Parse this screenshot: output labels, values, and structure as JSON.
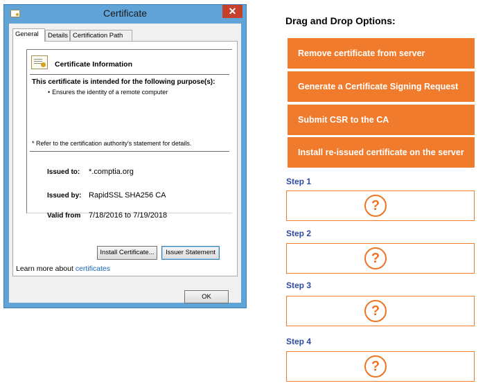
{
  "dialog": {
    "title": "Certificate",
    "close_glyph": "✕",
    "tabs": [
      {
        "label": "General",
        "active": true
      },
      {
        "label": "Details",
        "active": false
      },
      {
        "label": "Certification Path",
        "active": false
      }
    ],
    "info": {
      "heading": "Certificate Information",
      "purpose_title": "This certificate is intended for the following purpose(s):",
      "purposes": [
        "Ensures the identity of a remote computer"
      ],
      "refer_note": "* Refer to the certification authority's statement for details.",
      "issued_to_label": "Issued to:",
      "issued_to": "*.comptia.org",
      "issued_by_label": "Issued by:",
      "issued_by": "RapidSSL SHA256 CA",
      "valid_from_label": "Valid from",
      "valid_range": "7/18/2016 to 7/19/2018"
    },
    "install_button": "Install Certificate...",
    "issuer_button": "Issuer Statement",
    "learn_text": "Learn more about",
    "learn_link": "certificates",
    "ok_button": "OK",
    "icons": [
      "certificate-icon",
      "close-icon"
    ],
    "colors": {
      "titlebar": "#5fa3d7",
      "close": "#c7412a",
      "link": "#1565c0"
    }
  },
  "dragdrop": {
    "title": "Drag and Drop Options:",
    "options": [
      "Remove certificate from server",
      "Generate a Certificate Signing Request",
      "Submit CSR to the CA",
      "Install re-issued certificate on the server"
    ],
    "steps": [
      {
        "label": "Step 1",
        "placeholder": "?"
      },
      {
        "label": "Step 2",
        "placeholder": "?"
      },
      {
        "label": "Step 3",
        "placeholder": "?"
      },
      {
        "label": "Step 4",
        "placeholder": "?"
      }
    ],
    "colors": {
      "option": "#f07b2c",
      "step_label": "#2f4a9f"
    }
  }
}
